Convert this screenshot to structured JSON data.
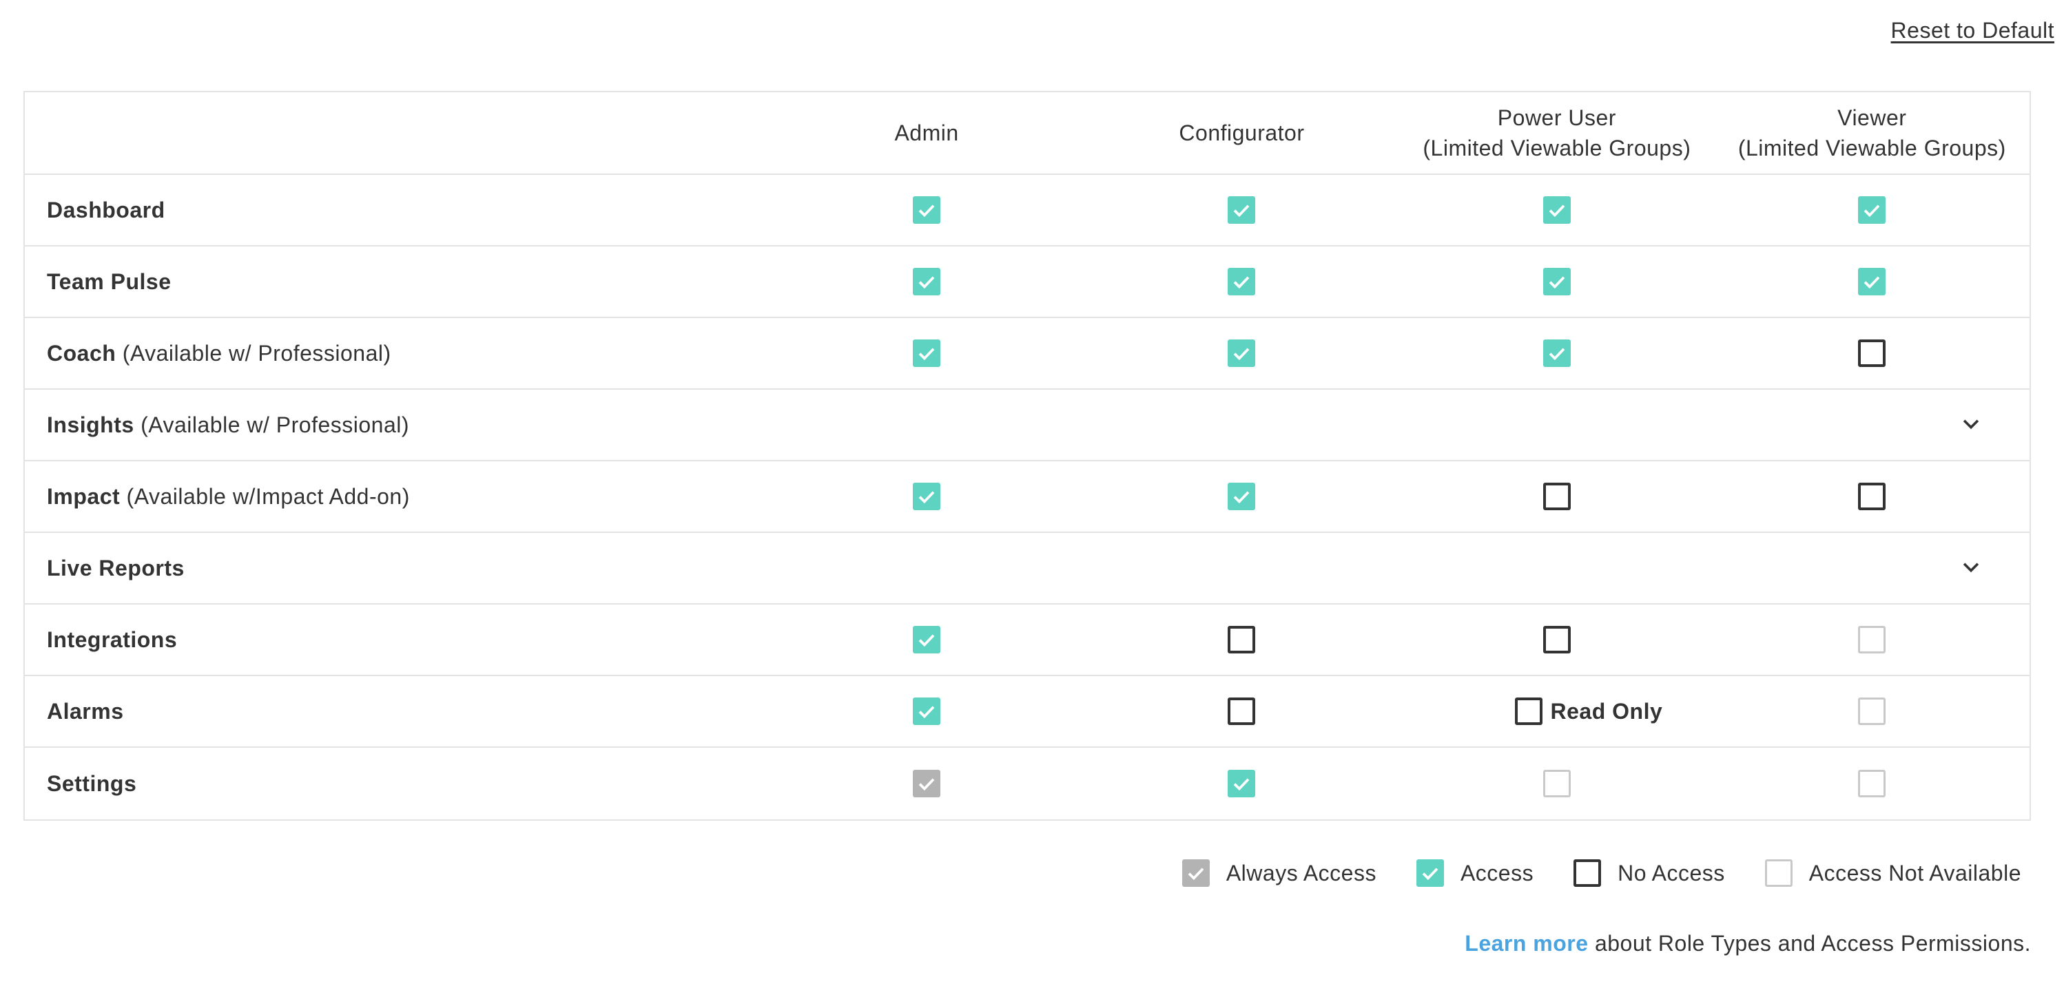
{
  "reset_label": "Reset to Default",
  "columns": [
    {
      "line1": "Admin",
      "line2": ""
    },
    {
      "line1": "Configurator",
      "line2": ""
    },
    {
      "line1": "Power User",
      "line2": "(Limited Viewable Groups)"
    },
    {
      "line1": "Viewer",
      "line2": "(Limited Viewable Groups)"
    }
  ],
  "rows": [
    {
      "name": "Dashboard",
      "note": "",
      "expandable": false,
      "states": [
        "access",
        "access",
        "access",
        "access"
      ]
    },
    {
      "name": "Team Pulse",
      "note": "",
      "expandable": false,
      "states": [
        "access",
        "access",
        "access",
        "access"
      ]
    },
    {
      "name": "Coach",
      "note": "(Available w/ Professional)",
      "expandable": false,
      "states": [
        "access",
        "access",
        "access",
        "none"
      ]
    },
    {
      "name": "Insights",
      "note": "(Available w/ Professional)",
      "expandable": true,
      "states": []
    },
    {
      "name": "Impact",
      "note": "(Available w/Impact Add-on)",
      "expandable": false,
      "states": [
        "access",
        "access",
        "none",
        "none"
      ]
    },
    {
      "name": "Live Reports",
      "note": "",
      "expandable": true,
      "states": []
    },
    {
      "name": "Integrations",
      "note": "",
      "expandable": false,
      "states": [
        "access",
        "none",
        "none",
        "na"
      ]
    },
    {
      "name": "Alarms",
      "note": "",
      "expandable": false,
      "states": [
        "access",
        "none",
        "none",
        "na"
      ],
      "power_user_extra": "Read Only"
    },
    {
      "name": "Settings",
      "note": "",
      "expandable": false,
      "states": [
        "always",
        "access",
        "na",
        "na"
      ]
    }
  ],
  "legend": {
    "always": "Always Access",
    "access": "Access",
    "none": "No Access",
    "na": "Access Not Available"
  },
  "footer": {
    "link": "Learn more",
    "text": " about Role Types and Access Permissions."
  },
  "colors": {
    "access": "#5ed3c2",
    "always": "#b3b3b3",
    "link": "#4aa3df"
  }
}
